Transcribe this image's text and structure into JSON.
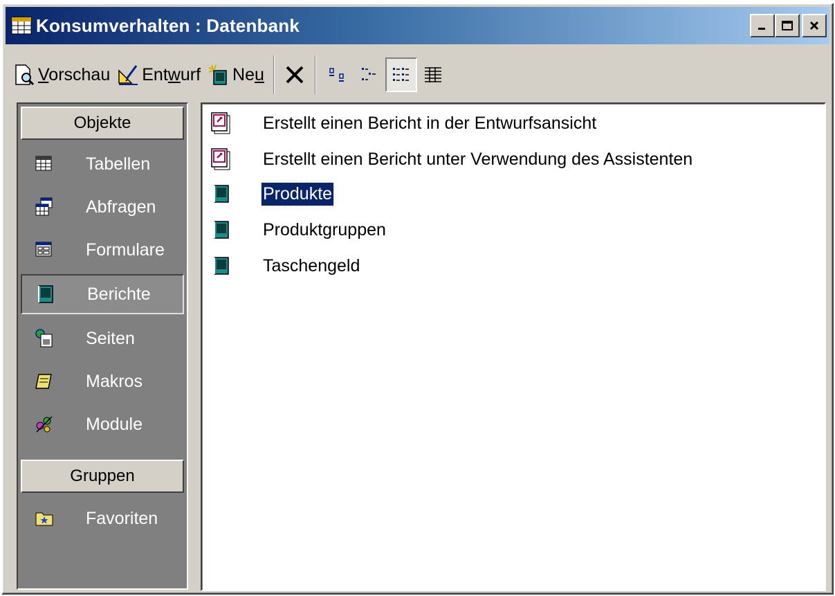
{
  "window": {
    "title": "Konsumverhalten : Datenbank",
    "controls": {
      "minimize": "_",
      "maximize": "□",
      "close": "×"
    }
  },
  "toolbar": {
    "preview": {
      "pre": "",
      "mnemonic": "V",
      "post": "orschau",
      "icon": "preview-icon"
    },
    "design": {
      "pre": "Ent",
      "mnemonic": "w",
      "post": "urf",
      "icon": "design-icon"
    },
    "new": {
      "pre": "Ne",
      "mnemonic": "u",
      "post": "",
      "icon": "new-icon"
    },
    "delete_icon": "delete-icon",
    "view_buttons": [
      "large-icons",
      "small-icons",
      "list",
      "details"
    ],
    "active_view": "list"
  },
  "sidebar": {
    "objects_header": "Objekte",
    "items": [
      {
        "label": "Tabellen",
        "icon": "table-icon"
      },
      {
        "label": "Abfragen",
        "icon": "query-icon"
      },
      {
        "label": "Formulare",
        "icon": "form-icon"
      },
      {
        "label": "Berichte",
        "icon": "report-icon",
        "selected": true
      },
      {
        "label": "Seiten",
        "icon": "page-icon"
      },
      {
        "label": "Makros",
        "icon": "macro-icon"
      },
      {
        "label": "Module",
        "icon": "module-icon"
      }
    ],
    "groups_header": "Gruppen",
    "groups": [
      {
        "label": "Favoriten",
        "icon": "favorites-icon"
      }
    ]
  },
  "list": {
    "items": [
      {
        "label": "Erstellt einen Bericht in der Entwurfsansicht",
        "icon": "wizard-report-icon"
      },
      {
        "label": "Erstellt einen Bericht unter Verwendung des Assistenten",
        "icon": "wizard-report-icon"
      },
      {
        "label": "Produkte",
        "icon": "report-icon",
        "selected": true
      },
      {
        "label": "Produktgruppen",
        "icon": "report-icon"
      },
      {
        "label": "Taschengeld",
        "icon": "report-icon"
      }
    ]
  },
  "colors": {
    "titlebar_start": "#0a246a",
    "titlebar_end": "#a6caf0",
    "face": "#d4d0c8",
    "sidebar_bg": "#808080",
    "selection": "#0a246a"
  }
}
